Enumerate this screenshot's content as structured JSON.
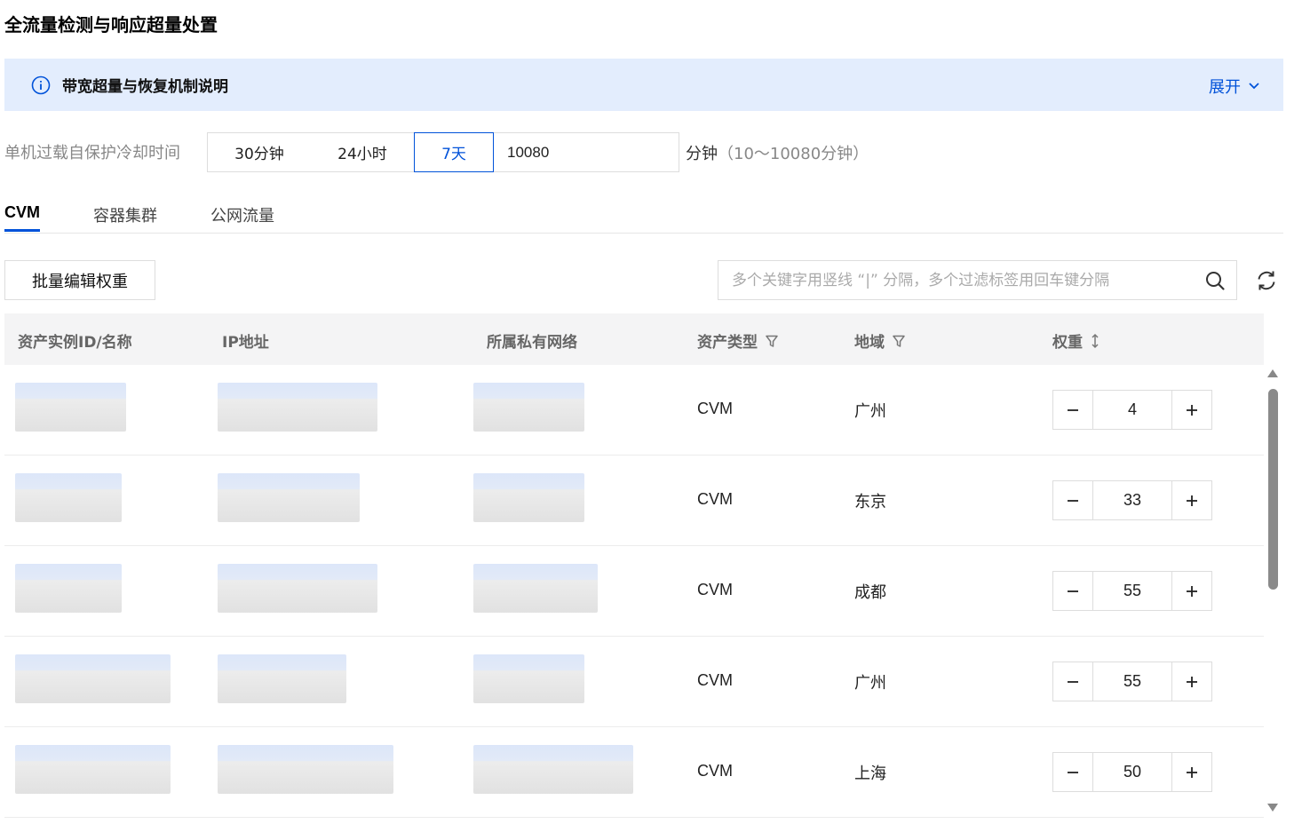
{
  "page": {
    "title": "全流量检测与响应超量处置"
  },
  "notice": {
    "text": "带宽超量与恢复机制说明",
    "expand_label": "展开"
  },
  "cooldown": {
    "label": "单机过载自保护冷却时间",
    "options": [
      "30分钟",
      "24小时",
      "7天"
    ],
    "selected": "7天",
    "value": "10080",
    "unit": "分钟",
    "hint": "（10～10080分钟）"
  },
  "tabs": [
    "CVM",
    "容器集群",
    "公网流量"
  ],
  "active_tab": "CVM",
  "toolbar": {
    "batch_edit_label": "批量编辑权重",
    "search_placeholder": "多个关键字用竖线 “|” 分隔，多个过滤标签用回车键分隔"
  },
  "table": {
    "columns": [
      "资产实例ID/名称",
      "IP地址",
      "所属私有网络",
      "资产类型",
      "地域",
      "权重"
    ],
    "rows": [
      {
        "type": "CVM",
        "region": "广州",
        "weight": "4"
      },
      {
        "type": "CVM",
        "region": "东京",
        "weight": "33"
      },
      {
        "type": "CVM",
        "region": "成都",
        "weight": "55"
      },
      {
        "type": "CVM",
        "region": "广州",
        "weight": "55"
      },
      {
        "type": "CVM",
        "region": "上海",
        "weight": "50"
      }
    ]
  },
  "icons": {
    "notice": "info-circle-icon",
    "expand": "chevron-down-icon",
    "search": "search-icon",
    "refresh": "refresh-icon",
    "filter": "filter-icon",
    "sort": "sort-icon",
    "minus": "minus-icon",
    "plus": "plus-icon"
  },
  "colors": {
    "accent": "#0052d9",
    "notice_bg": "#e3edfd",
    "header_bg": "#f4f4f5"
  }
}
